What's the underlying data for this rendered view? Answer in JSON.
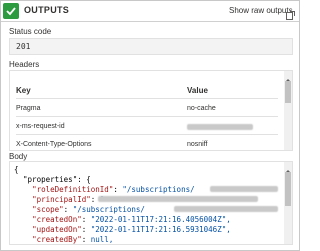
{
  "header": {
    "title": "OUTPUTS",
    "show_raw_label": "Show raw outputs"
  },
  "status": {
    "label": "Status code",
    "value": "201"
  },
  "headers": {
    "label": "Headers",
    "columns": [
      "Key",
      "Value"
    ],
    "rows": [
      {
        "key": "Pragma",
        "value": "no-cache"
      },
      {
        "key": "x-ms-request-id",
        "value": ""
      },
      {
        "key": "X-Content-Type-Options",
        "value": "nosniff"
      }
    ]
  },
  "body": {
    "label": "Body",
    "lines": [
      {
        "text": "{"
      },
      {
        "text": "  \"properties\": {"
      },
      {
        "key": "\"roleDefinitionId\"",
        "value": "\"/subscriptions/"
      },
      {
        "key": "\"principalId\"",
        "value": "\""
      },
      {
        "key": "\"scope\"",
        "value": "\"/subscriptions/"
      },
      {
        "key": "\"createdOn\"",
        "value": "\"2022-01-11T17:21:16.4056004Z\","
      },
      {
        "key": "\"updatedOn\"",
        "value": "\"2022-01-11T17:21:16.5931046Z\","
      },
      {
        "key": "\"createdBy\"",
        "value": "null,"
      }
    ]
  },
  "colors": {
    "success": "#2c9a3f",
    "json_key": "#a31515",
    "json_string": "#0451a5"
  }
}
